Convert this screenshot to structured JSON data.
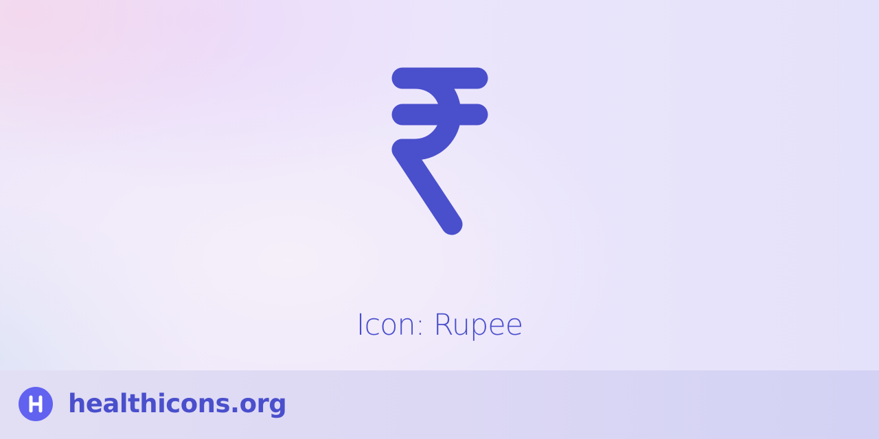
{
  "icon": {
    "name": "rupee-icon",
    "color": "#4a4fcc"
  },
  "title": {
    "prefix": "Icon:",
    "name": "Rupee"
  },
  "footer": {
    "logo_icon": "healthicons-h-logo-icon",
    "logo_color": "#6162f0",
    "site": "healthicons.org"
  }
}
